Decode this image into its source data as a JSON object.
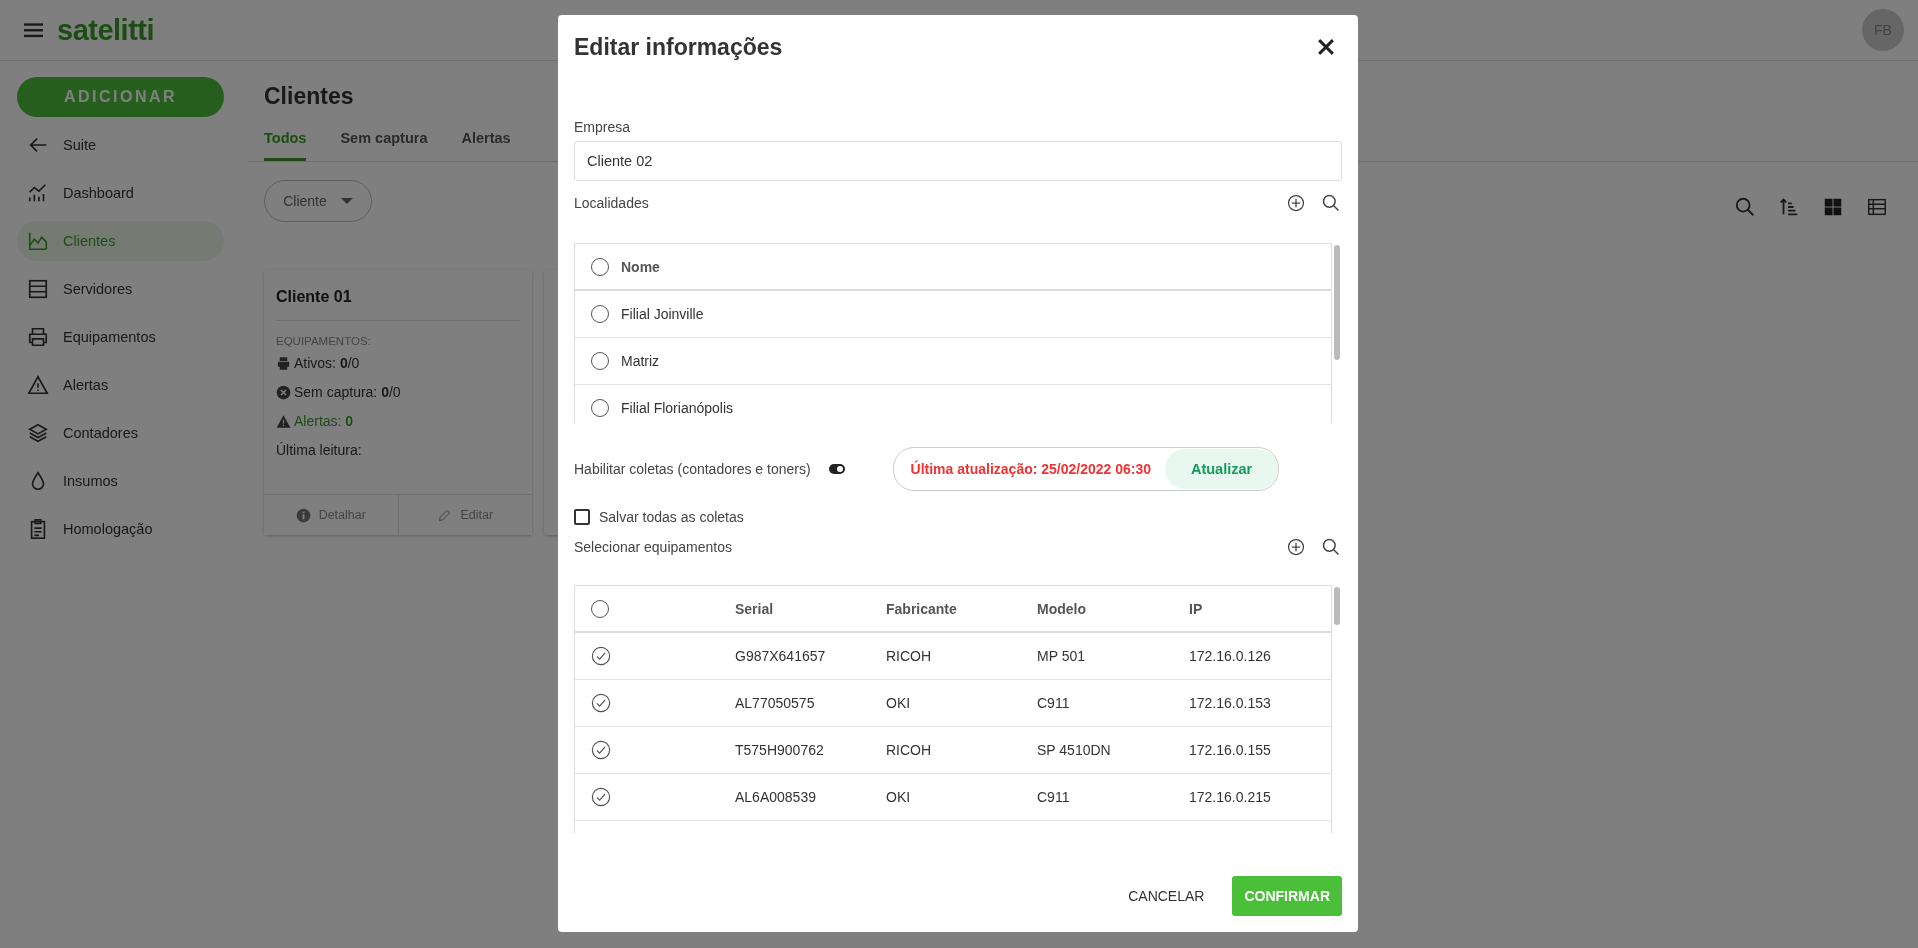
{
  "header": {
    "logo": "satelitti",
    "avatar": "FB"
  },
  "sidebar": {
    "add_button": "ADICIONAR",
    "items": [
      {
        "label": "Suite",
        "selected": false
      },
      {
        "label": "Dashboard",
        "selected": false
      },
      {
        "label": "Clientes",
        "selected": true
      },
      {
        "label": "Servidores",
        "selected": false
      },
      {
        "label": "Equipamentos",
        "selected": false
      },
      {
        "label": "Alertas",
        "selected": false
      },
      {
        "label": "Contadores",
        "selected": false
      },
      {
        "label": "Insumos",
        "selected": false
      },
      {
        "label": "Homologação",
        "selected": false
      }
    ]
  },
  "page": {
    "title": "Clientes",
    "tabs": [
      {
        "label": "Todos",
        "selected": true
      },
      {
        "label": "Sem captura",
        "selected": false
      },
      {
        "label": "Alertas",
        "selected": false
      }
    ],
    "filter": "Cliente",
    "cards": [
      {
        "title": "Cliente 01",
        "section": "EQUIPAMENTOS:",
        "ativos": "Ativos: **0**/0",
        "sem_captura": "Sem captura: **0**/0",
        "alertas": "Alertas: **0**",
        "ultima_leitura": "Última leitura:",
        "actions": [
          "Detalhar",
          "Editar"
        ]
      }
    ]
  },
  "modal": {
    "title": "Editar informações",
    "empresa": {
      "label": "Empresa",
      "value": "Cliente 02"
    },
    "localidades": {
      "label": "Localidades",
      "header": "Nome",
      "header_selected": false,
      "rows": [
        {
          "name": "Filial Joinville",
          "selected": false
        },
        {
          "name": "Matriz",
          "selected": false
        },
        {
          "name": "Filial Florianópolis",
          "selected": false
        }
      ]
    },
    "coletas": {
      "label": "Habilitar coletas (contadores e toners)",
      "on": true,
      "last_update": "Última atualização: 25/02/2022 06:30",
      "update_button": "Atualizar"
    },
    "salvar": {
      "label": "Salvar todas as coletas",
      "checked": false
    },
    "equipamentos": {
      "label": "Selecionar equipamentos",
      "columns": [
        "Serial",
        "Fabricante",
        "Modelo",
        "IP"
      ],
      "all_checked": false,
      "rows": [
        {
          "checked": true,
          "cells": [
            "G987X641657",
            "RICOH",
            "MP 501",
            "172.16.0.126"
          ]
        },
        {
          "checked": true,
          "cells": [
            "AL77050575",
            "OKI",
            "C911",
            "172.16.0.153"
          ]
        },
        {
          "checked": true,
          "cells": [
            "T575H900762",
            "RICOH",
            "SP 4510DN",
            "172.16.0.155"
          ]
        },
        {
          "checked": true,
          "cells": [
            "AL6A008539",
            "OKI",
            "C911",
            "172.16.0.215"
          ]
        }
      ]
    },
    "buttons": {
      "cancel": "CANCELAR",
      "confirm": "CONFIRMAR"
    }
  }
}
